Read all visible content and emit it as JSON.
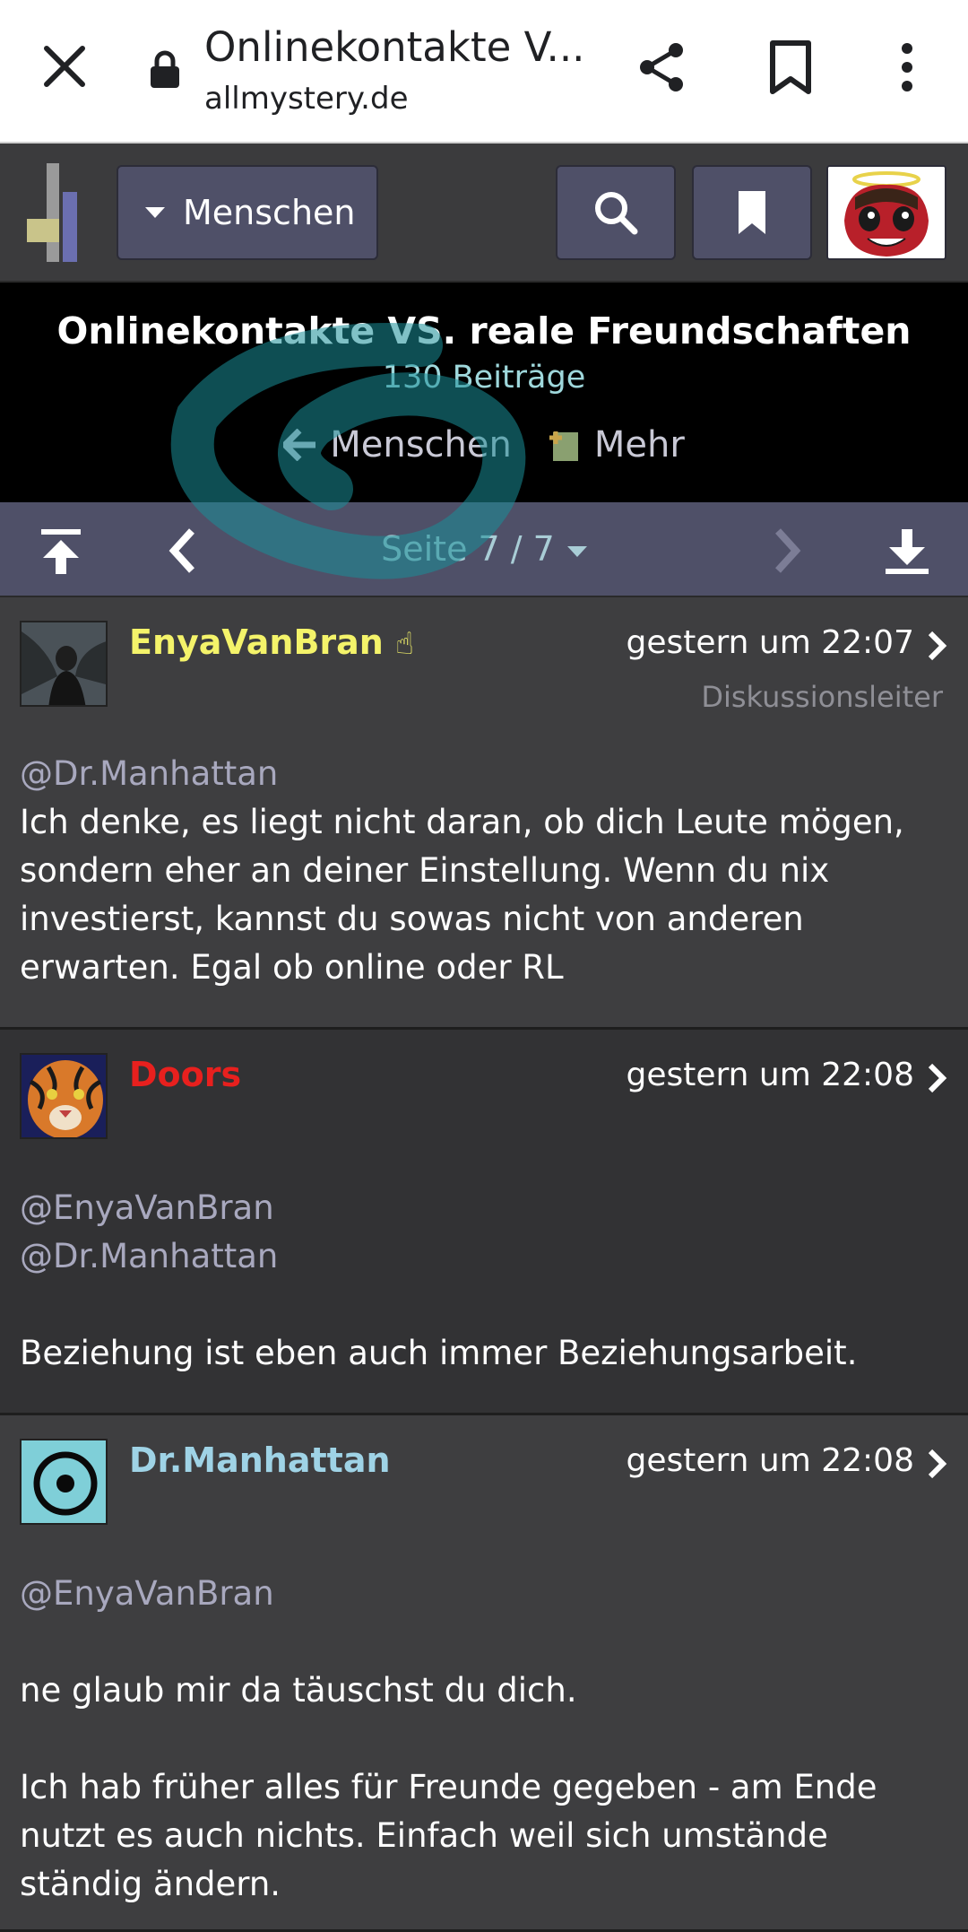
{
  "browser": {
    "title": "Onlinekontakte V...",
    "url": "allmystery.de",
    "icons": [
      "close-icon",
      "lock-icon",
      "share-icon",
      "bookmark-icon",
      "more-vert-icon"
    ]
  },
  "site_header": {
    "category_label": "Menschen",
    "icons": [
      "site-logo",
      "search-icon",
      "bookmark-icon",
      "user-avatar"
    ]
  },
  "thread": {
    "title": "Onlinekontakte VS. reale Freundschaften",
    "count": "130 Beiträge",
    "back_label": "Menschen",
    "more_label": "Mehr"
  },
  "pager": {
    "page_label": "Seite 7 / 7",
    "icons": [
      "first-page-icon",
      "prev-page-icon",
      "next-page-icon",
      "last-page-icon"
    ]
  },
  "colors": {
    "author_enya": "#f4f36a",
    "author_doors": "#e8201e",
    "author_manhattan": "#9fd3e6",
    "mention": "#a8a8be",
    "pager_bg": "#4f5068"
  },
  "posts": [
    {
      "author": "EnyaVanBran",
      "badge": "☝",
      "time": "gestern um 22:07",
      "role": "Diskussionsleiter",
      "mentions": [
        "@Dr.Manhattan"
      ],
      "text": "Ich denke, es liegt nicht daran, ob dich Leute mögen, sondern eher an deiner Einstellung. Wenn du nix investierst, kannst du sowas nicht von anderen erwarten. Egal ob online oder RL"
    },
    {
      "author": "Doors",
      "time": "gestern um 22:08",
      "mentions": [
        "@EnyaVanBran",
        "@Dr.Manhattan"
      ],
      "text": "Beziehung ist eben auch immer Beziehungsarbeit."
    },
    {
      "author": "Dr.Manhattan",
      "time": "gestern um 22:08",
      "mentions": [
        "@EnyaVanBran"
      ],
      "text": "ne glaub mir da täuschst du dich.",
      "text2": "Ich hab früher alles für Freunde gegeben - am Ende nutzt es auch nichts. Einfach weil sich umstände ständig ändern."
    }
  ]
}
